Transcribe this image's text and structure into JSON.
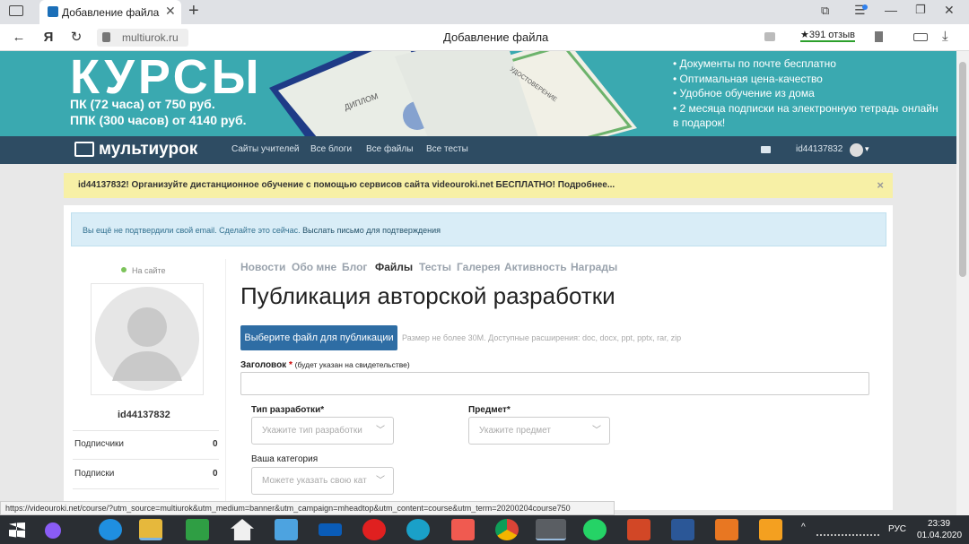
{
  "browser": {
    "tab_title": "Добавление файла",
    "address": "multiurok.ru",
    "page_title": "Добавление файла",
    "reviews": "★391 отзыв"
  },
  "banner": {
    "heading": "КУРСЫ",
    "line1": "ПК (72 часа) от 750 руб.",
    "line2": "ППК (300 часов) от 4140 руб.",
    "bullets": [
      "Документы по почте бесплатно",
      "Оптимальная цена-качество",
      "Удобное обучение из дома",
      "2 месяца подписки на электронную тетрадь онлайн в подарок!"
    ],
    "diploma_word": "ДИПЛОМ",
    "certificate_word": "УДОСТОВЕРЕНИЕ"
  },
  "site": {
    "logo": "мультиурок",
    "nav": [
      "Сайты учителей",
      "Все блоги",
      "Все файлы",
      "Все тесты"
    ],
    "user": "id44137832"
  },
  "notice": {
    "text": "id44137832! Организуйте дистанционное обучение с помощью сервисов сайта videouroki.net БЕСПЛАТНО! Подробнее...",
    "close": "×"
  },
  "email_alert": {
    "text": "Вы ещё не подтвердили свой email. Сделайте это сейчас.",
    "link": "Выслать письмо для подтверждения"
  },
  "profile": {
    "status": "На сайте",
    "username": "id44137832",
    "stats": [
      {
        "label": "Подписчики",
        "value": "0"
      },
      {
        "label": "Подписки",
        "value": "0"
      }
    ]
  },
  "profile_tabs": [
    "Новости",
    "Обо мне",
    "Блог",
    "Файлы",
    "Тесты",
    "Галерея",
    "Активность",
    "Награды"
  ],
  "active_tab": "Файлы",
  "form": {
    "title": "Публикация авторской разработки",
    "upload_button": "Выберите файл для публикации",
    "upload_hint": "Размер не более 30М. Доступные расширения: doc, docx, ppt, pptx, rar, zip",
    "header_label": "Заголовок",
    "header_req": "*",
    "header_note": "(будет указан на свидетельстве)",
    "type_label": "Тип разработки*",
    "type_placeholder": "Укажите тип разработки",
    "subject_label": "Предмет*",
    "subject_placeholder": "Укажите предмет",
    "category_label": "Ваша категория",
    "category_placeholder": "Можете указать свою кат"
  },
  "status_url": "https://videouroki.net/course/?utm_source=multiurok&utm_medium=banner&utm_campaign=mheadtop&utm_content=course&utm_term=20200204course750",
  "tray": {
    "lang": "РУС",
    "time": "23:39",
    "date": "01.04.2020"
  },
  "colors": {
    "banner": "#3aa9b0",
    "header": "#2e4c63",
    "notice": "#f7f0a6",
    "primary": "#2e6da4"
  }
}
